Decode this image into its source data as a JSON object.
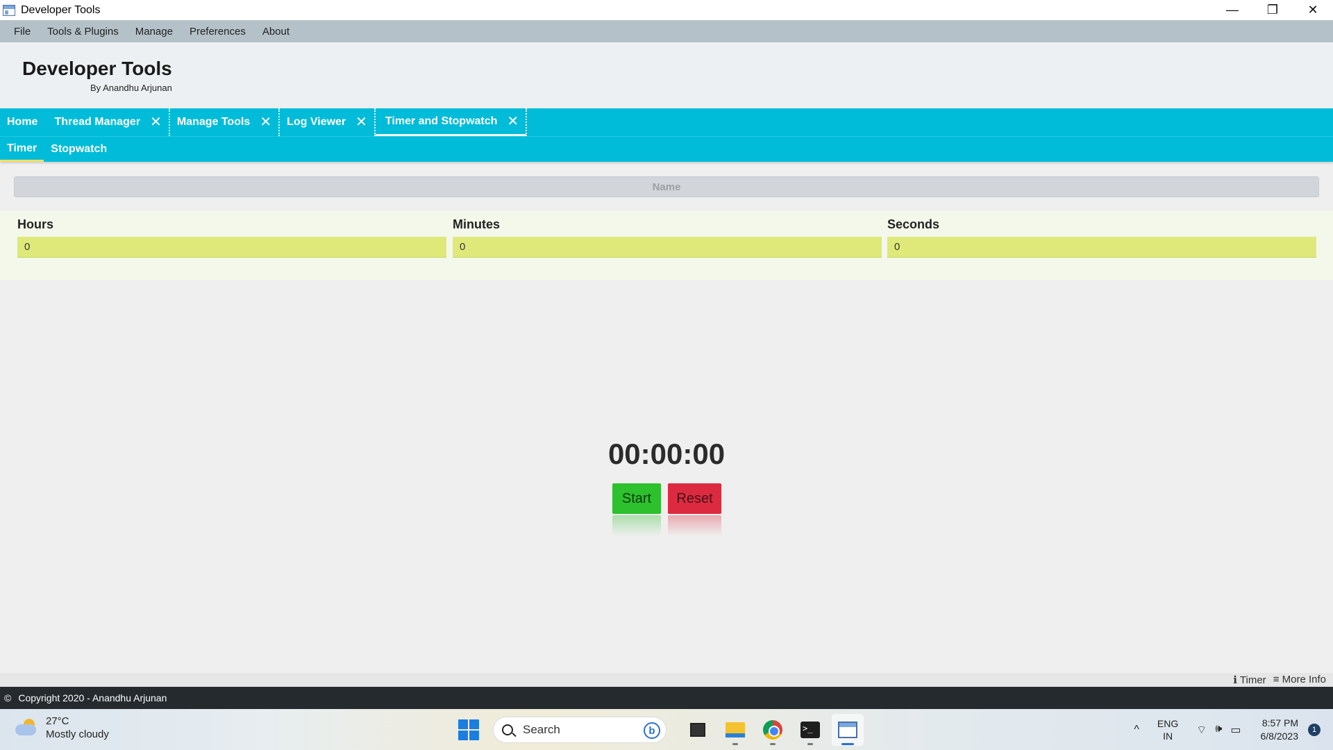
{
  "window": {
    "title": "Developer Tools",
    "minimize": "—",
    "restore": "❐",
    "close": "✕"
  },
  "menu": [
    "File",
    "Tools & Plugins",
    "Manage",
    "Preferences",
    "About"
  ],
  "header": {
    "title": "Developer Tools",
    "subtitle": "By Anandhu Arjunan"
  },
  "tabs": [
    {
      "label": "Home"
    },
    {
      "label": "Thread Manager",
      "close": "✕"
    },
    {
      "label": "Manage Tools",
      "close": "✕"
    },
    {
      "label": "Log Viewer",
      "close": "✕"
    },
    {
      "label": "Timer and Stopwatch",
      "close": "✕"
    }
  ],
  "subtabs": [
    "Timer",
    "Stopwatch"
  ],
  "name_field": {
    "placeholder": "Name"
  },
  "fields": [
    {
      "label": "Hours",
      "value": "0"
    },
    {
      "label": "Minutes",
      "value": "0"
    },
    {
      "label": "Seconds",
      "value": "0"
    }
  ],
  "timer": {
    "display": "00:00:00",
    "start": "Start",
    "reset": "Reset"
  },
  "status": {
    "info_label": "Timer",
    "more_label": "More Info",
    "info_icon": "ℹ",
    "more_icon": "≡"
  },
  "footer": {
    "copyright_icon": "©",
    "text": "Copyright 2020 - Anandhu Arjunan"
  },
  "taskbar": {
    "weather_temp": "27°C",
    "weather_desc": "Mostly cloudy",
    "search_label": "Search",
    "bing": "b",
    "terminal_glyph": ">_",
    "tray_chevron": "^",
    "lang_1": "ENG",
    "lang_2": "IN",
    "wifi_icon": "⌔",
    "volume_icon": "🕪",
    "battery_icon": "▭",
    "time": "8:57 PM",
    "date": "6/8/2023",
    "notifications": "1"
  },
  "colors": {
    "accent": "#00bcd8",
    "start": "#2dc12d",
    "reset": "#dc2b40",
    "input": "#dfe97a"
  }
}
